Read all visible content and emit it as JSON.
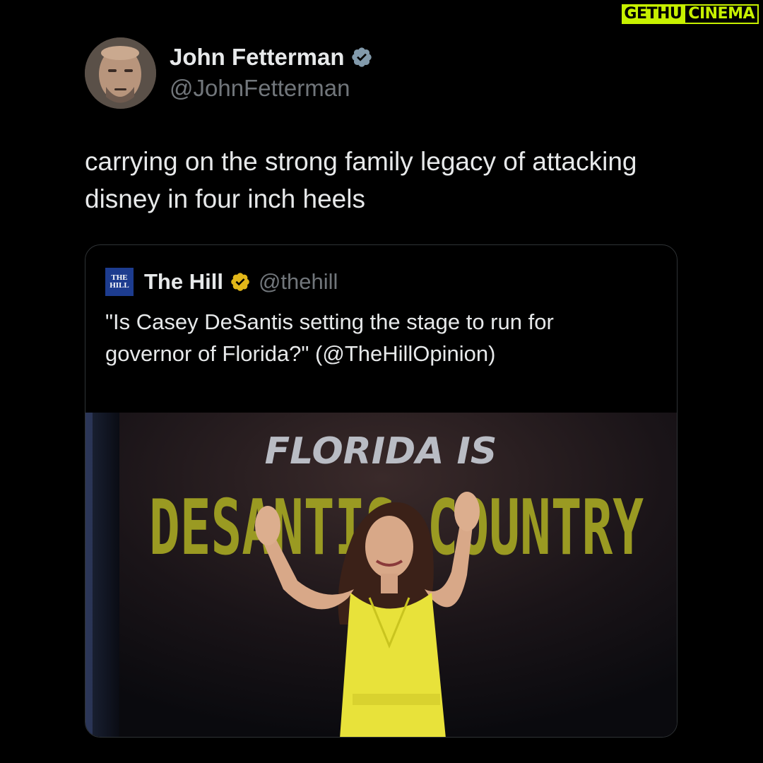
{
  "watermark": {
    "part1": "GETHU",
    "part2": "CINEMA"
  },
  "tweet": {
    "author_name": "John Fetterman",
    "author_handle": "@JohnFetterman",
    "text_line1": "carrying on the strong family legacy of attacking",
    "text_line2": "disney in four inch heels"
  },
  "quoted_tweet": {
    "logo_line1": "THE",
    "logo_line2": "HILL",
    "name": "The Hill",
    "handle": "@thehill",
    "text_line1": "\"Is Casey DeSantis setting the stage to run for",
    "text_line2": "governor of Florida?\" (@TheHillOpinion)",
    "image": {
      "sign_line1": "FLORIDA IS",
      "sign_line2": "DESANTIS COUNTRY"
    }
  },
  "colors": {
    "background": "#000000",
    "text": "#e7e9ea",
    "muted": "#71767b",
    "border": "#2f3336",
    "verified_blue": "#829aab",
    "verified_gold": "#e2b719",
    "watermark": "#c7f000",
    "dress_yellow": "#e8e23a"
  }
}
